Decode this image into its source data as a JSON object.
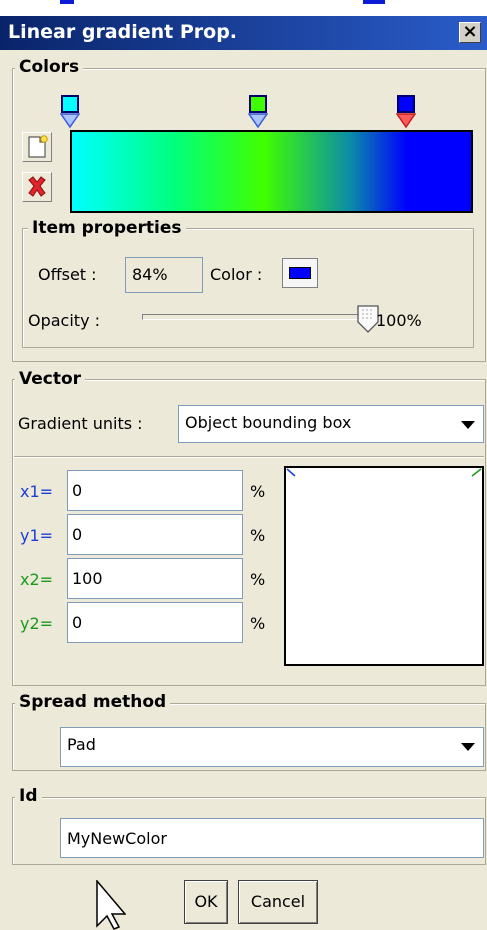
{
  "window": {
    "title": "Linear gradient Prop.",
    "close_glyph": "×"
  },
  "colors_section": {
    "legend": "Colors",
    "stops": [
      {
        "offset_pct": 0,
        "color": "#00ffff",
        "selected": false
      },
      {
        "offset_pct": 48,
        "color": "#40ff00",
        "selected": false
      },
      {
        "offset_pct": 84,
        "color": "#0000ff",
        "selected": true
      }
    ],
    "add_stop_icon": "new-document-icon",
    "delete_stop_icon": "red-x-icon"
  },
  "item_properties": {
    "legend": "Item properties",
    "offset_label": "Offset :",
    "offset_value": "84%",
    "color_label": "Color :",
    "color_value": "#0000ff",
    "opacity_label": "Opacity :",
    "opacity_value": "100%",
    "opacity_fraction": 1.0
  },
  "vector": {
    "legend": "Vector",
    "units_label": "Gradient units :",
    "units_value": "Object bounding box",
    "coords": [
      {
        "label": "x1=",
        "value": "0",
        "unit": "%",
        "color": "#1a3fd6"
      },
      {
        "label": "y1=",
        "value": "0",
        "unit": "%",
        "color": "#1a3fd6"
      },
      {
        "label": "x2=",
        "value": "100",
        "unit": "%",
        "color": "#1a9a1a"
      },
      {
        "label": "y2=",
        "value": "0",
        "unit": "%",
        "color": "#1a9a1a"
      }
    ]
  },
  "spread": {
    "legend": "Spread method",
    "value": "Pad"
  },
  "id_section": {
    "legend": "Id",
    "value": "MyNewColor"
  },
  "buttons": {
    "ok": "OK",
    "cancel": "Cancel"
  }
}
